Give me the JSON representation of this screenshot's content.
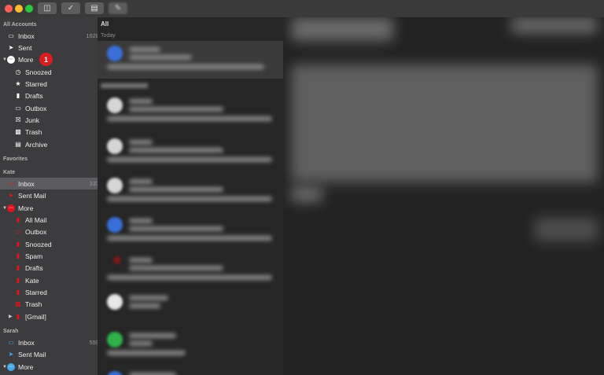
{
  "sidebar": {
    "all_accounts": {
      "header": "All Accounts",
      "inbox": {
        "label": "Inbox",
        "count": "1628"
      },
      "sent": {
        "label": "Sent"
      },
      "more": {
        "label": "More",
        "badge": "1"
      },
      "sub": [
        {
          "label": "Snoozed"
        },
        {
          "label": "Starred"
        },
        {
          "label": "Drafts"
        },
        {
          "label": "Outbox"
        },
        {
          "label": "Junk"
        },
        {
          "label": "Trash"
        },
        {
          "label": "Archive"
        }
      ]
    },
    "favorites": {
      "header": "Favorites"
    },
    "kate": {
      "header": "Kate",
      "inbox": {
        "label": "Inbox",
        "count": "333"
      },
      "sent": {
        "label": "Sent Mail"
      },
      "more": {
        "label": "More"
      },
      "sub": [
        {
          "label": "All Mail"
        },
        {
          "label": "Outbox"
        },
        {
          "label": "Snoozed"
        },
        {
          "label": "Spam"
        },
        {
          "label": "Drafts"
        },
        {
          "label": "Kate"
        },
        {
          "label": "Starred"
        },
        {
          "label": "Trash"
        },
        {
          "label": "[Gmail]"
        }
      ]
    },
    "sarah": {
      "header": "Sarah",
      "inbox": {
        "label": "Inbox",
        "count": "559"
      },
      "sent": {
        "label": "Sent Mail"
      },
      "more": {
        "label": "More"
      }
    }
  },
  "list": {
    "filter": "All",
    "today": "Today"
  },
  "colors": {
    "red_folder": "#e0141e",
    "blue_folder": "#4aa8e8",
    "badge": "#d81e1e"
  }
}
